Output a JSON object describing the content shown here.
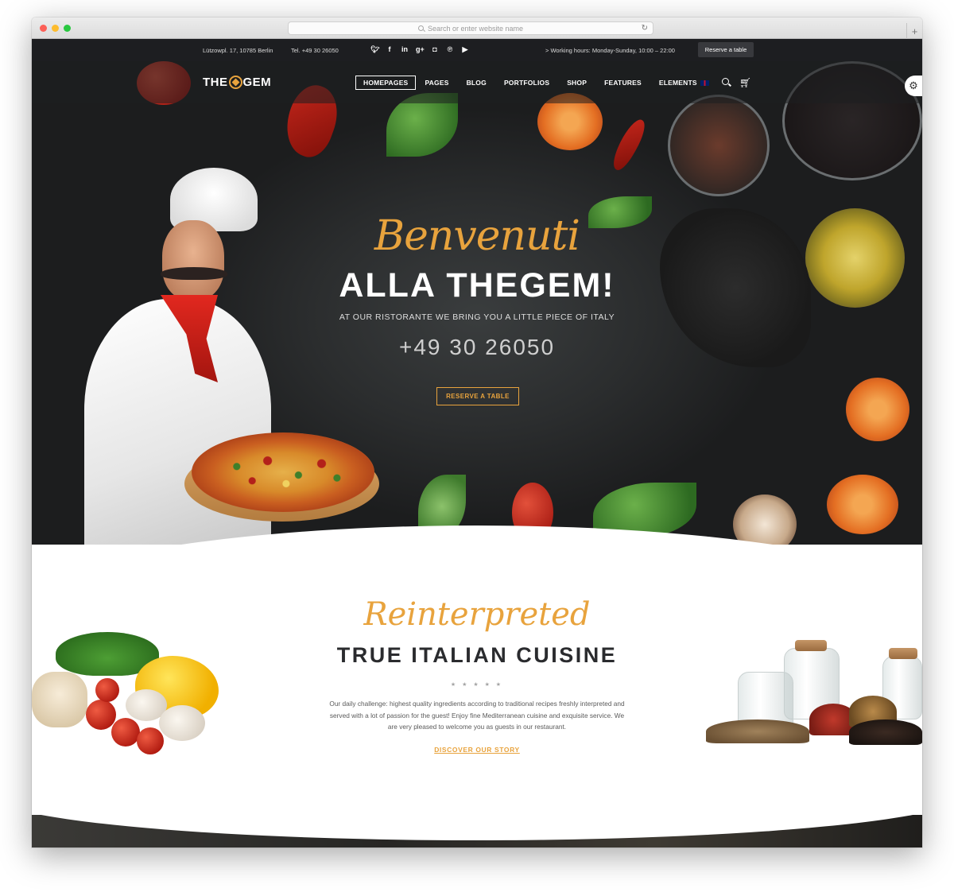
{
  "browser": {
    "url_placeholder": "Search or enter website name",
    "reload_icon": "reload-icon",
    "new_tab_icon": "plus-icon"
  },
  "topbar": {
    "address": "Lützowpl. 17, 10785 Berlin",
    "phone": "Tel. +49 30 26050",
    "socials": [
      "twitter-icon",
      "facebook-icon",
      "linkedin-icon",
      "googleplus-icon",
      "instagram-icon",
      "pinterest-icon",
      "youtube-icon"
    ],
    "hours": "> Working hours: Monday-Sunday, 10:00 – 22:00",
    "reserve_button": "Reserve a table"
  },
  "nav": {
    "logo_left": "THE",
    "logo_right": "GEM",
    "items": [
      "HOMEPAGES",
      "PAGES",
      "BLOG",
      "PORTFOLIOS",
      "SHOP",
      "FEATURES",
      "ELEMENTS"
    ],
    "active_index": 0
  },
  "hero": {
    "script": "Benvenuti",
    "title": "ALLA THEGEM!",
    "subtitle": "AT OUR RISTORANTE WE BRING YOU A LITTLE PIECE OF ITALY",
    "phone": "+49 30 26050",
    "button": "RESERVE A TABLE"
  },
  "intro": {
    "script": "Reinterpreted",
    "title": "TRUE ITALIAN CUISINE",
    "stars": "★ ★ ★ ★ ★",
    "description": "Our daily challenge: highest quality ingredients according to traditional recipes freshly interpreted and served with a lot of passion for the guest! Enjoy fine Mediterranean cuisine and exquisite service. We are very pleased to welcome you as guests in our restaurant.",
    "link": "DISCOVER OUR STORY"
  },
  "colors": {
    "accent": "#e8a33d",
    "topbar": "#1d1e21",
    "text_dark": "#2a2b2e"
  }
}
